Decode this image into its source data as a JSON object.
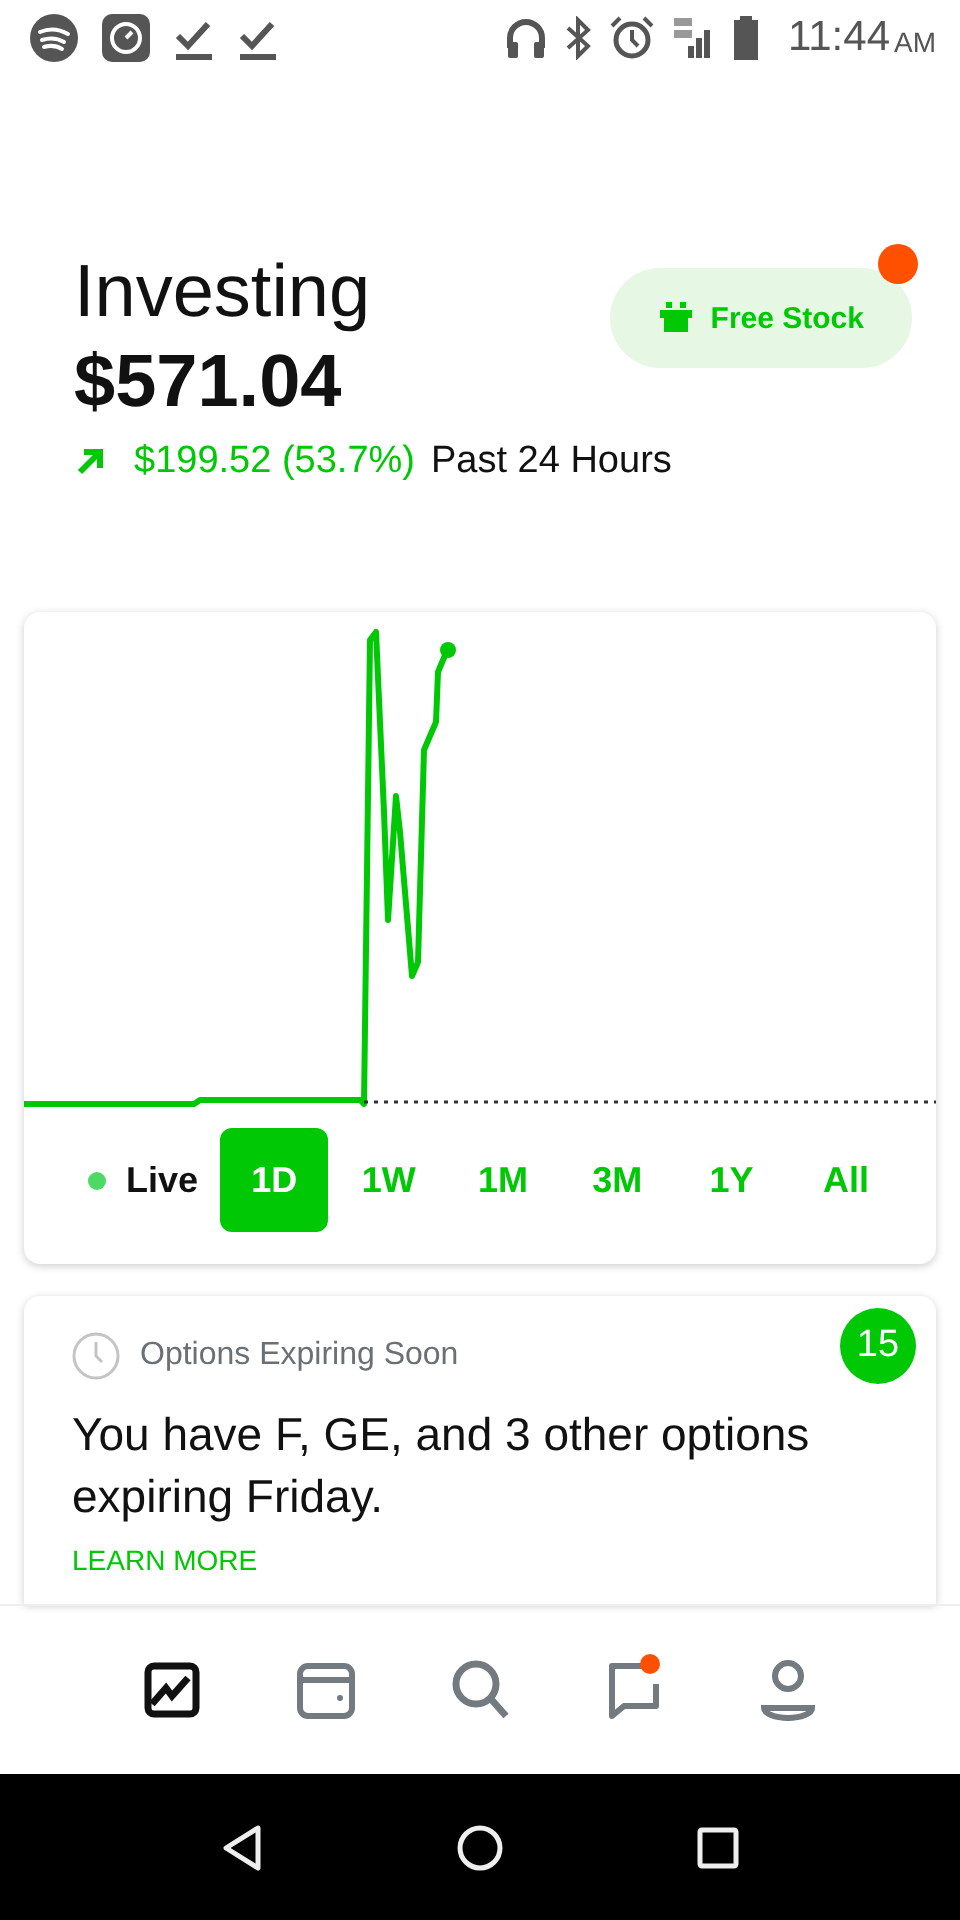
{
  "status_bar": {
    "time": "11:44",
    "ampm": "AM"
  },
  "header": {
    "title": "Investing",
    "value": "$571.04",
    "change": "$199.52 (53.7%)",
    "period": "Past 24 Hours",
    "free_stock": {
      "label": "Free Stock",
      "notification": true
    }
  },
  "chart": {
    "live_label": "Live",
    "ranges": [
      {
        "label": "1D",
        "selected": true
      },
      {
        "label": "1W",
        "selected": false
      },
      {
        "label": "1M",
        "selected": false
      },
      {
        "label": "3M",
        "selected": false
      },
      {
        "label": "1Y",
        "selected": false
      },
      {
        "label": "All",
        "selected": false
      }
    ]
  },
  "options_card": {
    "title": "Options Expiring Soon",
    "count": "15",
    "message": "You have F, GE, and 3 other options expiring Friday.",
    "link": "LEARN MORE"
  },
  "bottom_nav": [
    {
      "kind": "portfolio",
      "selected": true,
      "notification": false
    },
    {
      "kind": "wallet",
      "selected": false,
      "notification": false
    },
    {
      "kind": "search",
      "selected": false,
      "notification": false
    },
    {
      "kind": "messages",
      "selected": false,
      "notification": true
    },
    {
      "kind": "account",
      "selected": false,
      "notification": false
    }
  ]
}
